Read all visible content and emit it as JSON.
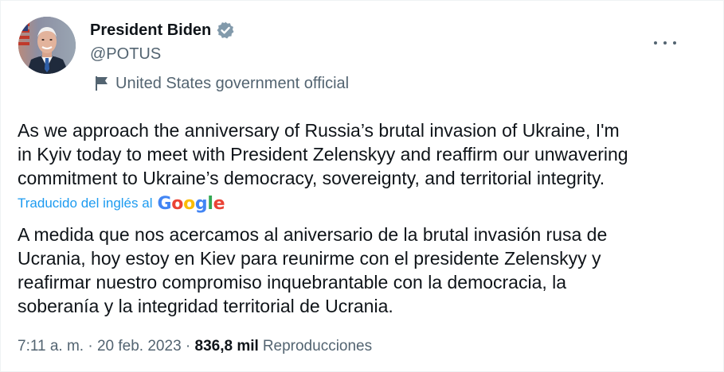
{
  "author": {
    "name": "President Biden",
    "handle": "@POTUS",
    "label": "United States government official"
  },
  "tweet": {
    "original_lines": [
      "As we approach the anniversary of Russia’s brutal invasion of Ukraine, I'm",
      "in Kyiv today to meet with President Zelenskyy and reaffirm our unwavering",
      "commitment to Ukraine’s democracy, sovereignty, and territorial integrity."
    ],
    "translation_notice": "Traducido del inglés al",
    "translation_provider": "Google",
    "translated_lines": [
      "A medida que nos acercamos al aniversario de la brutal invasión rusa de",
      "Ucrania, hoy estoy en Kiev para reunirme con el presidente Zelenskyy y",
      "reafirmar nuestro compromiso inquebrantable con la democracia, la",
      "soberanía y la integridad territorial de Ucrania."
    ]
  },
  "meta": {
    "time": "7:11 a. m.",
    "separator": " · ",
    "date": "20 feb. 2023",
    "views_count": "836,8 mil",
    "views_label": "Reproducciones"
  },
  "icons": {
    "verified": "verified-badge-icon",
    "government": "flag-icon",
    "more": "more-options-icon"
  },
  "colors": {
    "text_primary": "#0f1419",
    "text_secondary": "#536471",
    "link": "#1d9bf0",
    "badge_gray": "#829aab",
    "google_blue": "#4285f4",
    "google_red": "#ea4335",
    "google_yellow": "#fbbc05",
    "google_green": "#34a853"
  }
}
